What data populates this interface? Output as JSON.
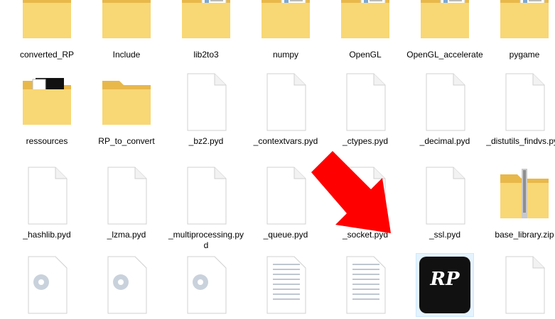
{
  "rows": [
    {
      "y": 0,
      "items": [
        {
          "name": "converted_RP",
          "type": "folder"
        },
        {
          "name": "Include",
          "type": "folder"
        },
        {
          "name": "lib2to3",
          "type": "folder-docs"
        },
        {
          "name": "numpy",
          "type": "folder-docs"
        },
        {
          "name": "OpenGL",
          "type": "folder-docs"
        },
        {
          "name": "OpenGL_accelerate",
          "type": "folder-docs"
        },
        {
          "name": "pygame",
          "type": "folder-docs"
        }
      ]
    },
    {
      "y": 1,
      "items": [
        {
          "name": "ressources",
          "type": "folder-rp"
        },
        {
          "name": "RP_to_convert",
          "type": "folder"
        },
        {
          "name": "_bz2.pyd",
          "type": "file"
        },
        {
          "name": "_contextvars.pyd",
          "type": "file"
        },
        {
          "name": "_ctypes.pyd",
          "type": "file"
        },
        {
          "name": "_decimal.pyd",
          "type": "file"
        },
        {
          "name": "_distutils_findvs.pyd",
          "type": "file"
        }
      ]
    },
    {
      "y": 2,
      "items": [
        {
          "name": "_hashlib.pyd",
          "type": "file"
        },
        {
          "name": "_lzma.pyd",
          "type": "file"
        },
        {
          "name": "_multiprocessing.pyd",
          "type": "file"
        },
        {
          "name": "_queue.pyd",
          "type": "file"
        },
        {
          "name": "_socket.pyd",
          "type": "file"
        },
        {
          "name": "_ssl.pyd",
          "type": "file"
        },
        {
          "name": "base_library.zip",
          "type": "zip"
        }
      ]
    },
    {
      "y": 3,
      "items": [
        {
          "name": "",
          "type": "gear"
        },
        {
          "name": "",
          "type": "gear"
        },
        {
          "name": "",
          "type": "gear"
        },
        {
          "name": "",
          "type": "text"
        },
        {
          "name": "",
          "type": "text"
        },
        {
          "name": "",
          "type": "rp-app"
        },
        {
          "name": "",
          "type": "file"
        }
      ]
    }
  ],
  "colors": {
    "folder": "#f8d775",
    "folder_dark": "#e8b84a",
    "arrow": "#ff0000",
    "selection": "#e5f3ff"
  }
}
